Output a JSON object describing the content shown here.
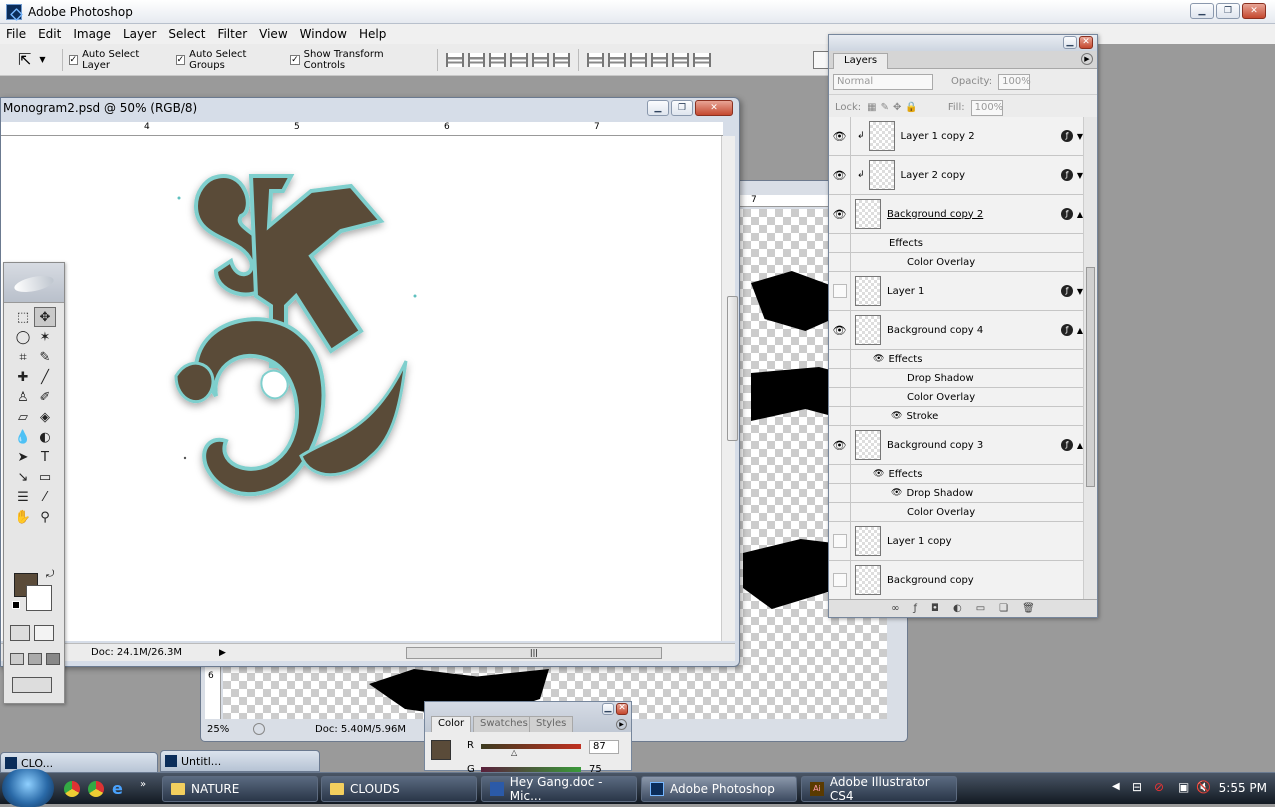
{
  "app": {
    "title": "Adobe Photoshop"
  },
  "menu": [
    "File",
    "Edit",
    "Image",
    "Layer",
    "Select",
    "Filter",
    "View",
    "Window",
    "Help"
  ],
  "options": {
    "auto_select_layer": "Auto Select Layer",
    "auto_select_groups": "Auto Select Groups",
    "show_transform": "Show Transform Controls"
  },
  "doc_main": {
    "title": "Monogram2.psd @ 50% (RGB/8)",
    "ruler_marks": [
      "4",
      "5",
      "6",
      "7"
    ],
    "status": "Doc: 24.1M/26.3M"
  },
  "doc_second": {
    "zoom": "25%",
    "status": "Doc: 5.40M/5.96M",
    "ruler_mark": "7",
    "side_ruler_mark": "6"
  },
  "layers_panel": {
    "tab": "Layers",
    "blend": "Normal",
    "opacity_label": "Opacity:",
    "opacity": "100%",
    "lock_label": "Lock:",
    "fill_label": "Fill:",
    "fill": "100%",
    "rows": [
      {
        "name": "Layer 1 copy 2",
        "kind": "layer",
        "visible": true
      },
      {
        "name": "Layer 2 copy",
        "kind": "layer",
        "visible": true
      },
      {
        "name": "Background copy 2",
        "kind": "layer",
        "visible": true
      },
      {
        "name": "Effects",
        "kind": "effects-header",
        "visible": false
      },
      {
        "name": "Color Overlay",
        "kind": "effect",
        "visible": false
      },
      {
        "name": "Layer 1",
        "kind": "layer",
        "visible": false
      },
      {
        "name": "Background copy 4",
        "kind": "layer",
        "visible": true
      },
      {
        "name": "Effects",
        "kind": "effects-header",
        "visible": true
      },
      {
        "name": "Drop Shadow",
        "kind": "effect",
        "visible": false
      },
      {
        "name": "Color Overlay",
        "kind": "effect",
        "visible": false
      },
      {
        "name": "Stroke",
        "kind": "effect",
        "visible": true
      },
      {
        "name": "Background copy 3",
        "kind": "layer",
        "visible": true
      },
      {
        "name": "Effects",
        "kind": "effects-header",
        "visible": true
      },
      {
        "name": "Drop Shadow",
        "kind": "effect",
        "visible": true
      },
      {
        "name": "Color Overlay",
        "kind": "effect",
        "visible": false
      },
      {
        "name": "Layer 1 copy",
        "kind": "layer",
        "visible": false
      },
      {
        "name": "Background copy",
        "kind": "layer",
        "visible": false
      }
    ]
  },
  "color_panel": {
    "tabs": [
      "Color",
      "Swatches",
      "Styles"
    ],
    "r_label": "R",
    "r_value": "87",
    "g_label": "G",
    "g_value": "75"
  },
  "taskbar": {
    "items": [
      "NATURE",
      "CLOUDS",
      "Hey Gang.doc - Mic...",
      "Adobe Photoshop",
      "Adobe Illustrator CS4"
    ],
    "mini": [
      "CLO...",
      "Untitl..."
    ],
    "clock": "5:55 PM"
  },
  "colors": {
    "foreground": "#5a4b39",
    "teal": "#5fc0bf",
    "taskbar": "#1d2633"
  }
}
